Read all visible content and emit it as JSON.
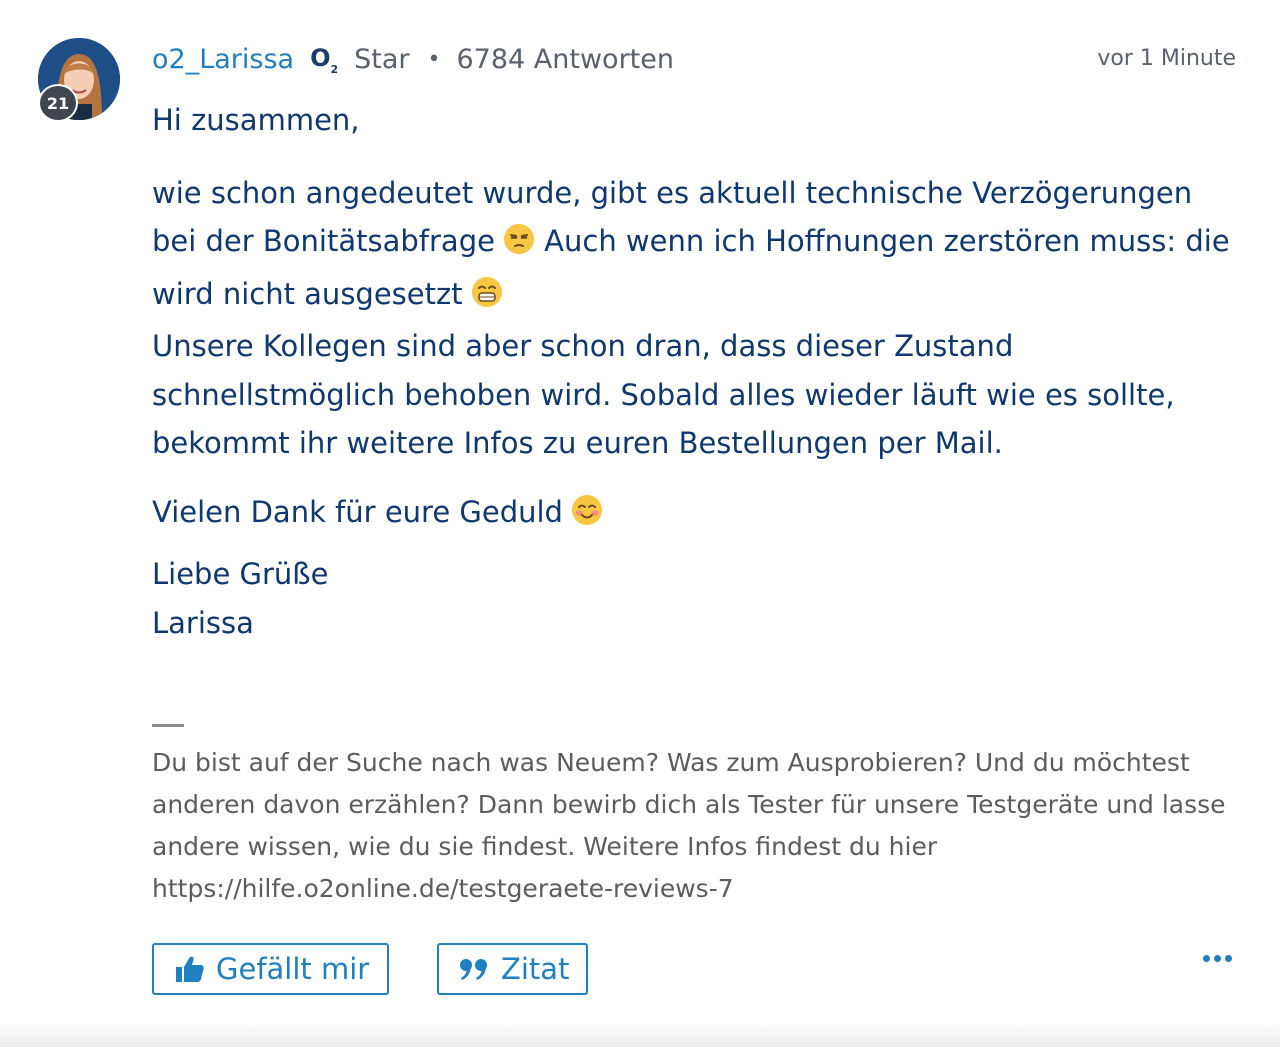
{
  "post": {
    "author": {
      "username": "o2_Larissa",
      "brand": "O",
      "brand_sub": "2",
      "rank": "Star",
      "separator": "•",
      "replies": "6784 Antworten",
      "avatar_badge": "21"
    },
    "timestamp": "vor 1 Minute",
    "body": {
      "greeting": "Hi zusammen,",
      "para1_part1": "wie schon angedeutet wurde, gibt es aktuell technische Verzögerungen bei der Bonitätsabfrage",
      "para1_part2": "Auch wenn ich Hoffnungen zerstören muss: die wird nicht ausgesetzt",
      "para2": "Unsere Kollegen sind aber schon dran, dass dieser Zustand schnellstmöglich behoben wird. Sobald alles wieder läuft wie es sollte, bekommt ihr weitere Infos zu euren Bestellungen per Mail.",
      "thanks": "Vielen Dank für eure Geduld",
      "closing": "Liebe Grüße",
      "name": "Larissa"
    },
    "signature": {
      "text": "Du bist auf der Suche nach was Neuem? Was zum Ausprobieren? Und du möchtest anderen davon erzählen? Dann bewirb dich als Tester für unsere Testgeräte und lasse andere wissen, wie du sie findest. Weitere Infos findest du hier",
      "link": "https://hilfe.o2online.de/testgeraete-reviews-7"
    },
    "actions": {
      "like_label": "Gefällt mir",
      "quote_label": "Zitat"
    }
  },
  "colors": {
    "accent": "#1f7fc1",
    "body_text": "#0f3870",
    "meta_text": "#58616c",
    "signature_text": "#5c5c5c"
  },
  "icons": {
    "like": "thumbs-up-icon",
    "quote": "quote-icon",
    "more": "more-dots-icon",
    "emoji1": "unamused-face-emoji",
    "emoji2": "grinning-face-emoji",
    "emoji3": "smiling-face-emoji"
  }
}
